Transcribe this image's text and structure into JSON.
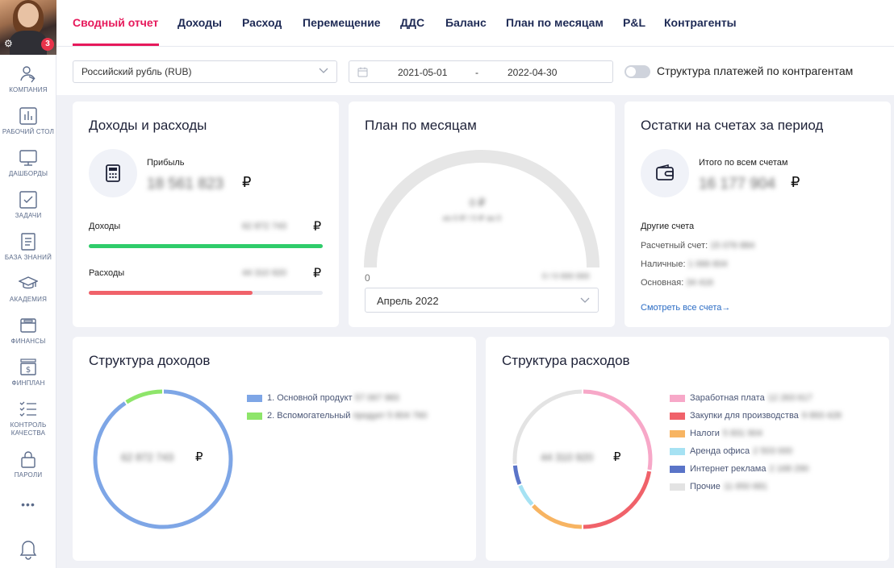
{
  "user": {
    "notifications": "3"
  },
  "sidebar": {
    "items": [
      {
        "label": "КОМПАНИЯ",
        "icon": "company-icon"
      },
      {
        "label": "РАБОЧИЙ СТОЛ",
        "icon": "chart-bars-icon"
      },
      {
        "label": "ДАШБОРДЫ",
        "icon": "monitor-icon"
      },
      {
        "label": "ЗАДАЧИ",
        "icon": "checkbox-icon"
      },
      {
        "label": "БАЗА ЗНАНИЙ",
        "icon": "document-icon"
      },
      {
        "label": "АКАДЕМИЯ",
        "icon": "graduation-cap-icon"
      },
      {
        "label": "ФИНАНСЫ",
        "icon": "wallet-icon"
      },
      {
        "label": "ФИНПЛАН",
        "icon": "dollar-icon"
      },
      {
        "label": "КОНТРОЛЬ КАЧЕСТВА",
        "icon": "checklist-icon"
      },
      {
        "label": "ПАРОЛИ",
        "icon": "lock-icon"
      }
    ],
    "more": "•••"
  },
  "tabs": [
    {
      "label": "Сводный отчет",
      "active": true
    },
    {
      "label": "Доходы"
    },
    {
      "label": "Расход"
    },
    {
      "label": "Перемещение"
    },
    {
      "label": "ДДС"
    },
    {
      "label": "Баланс"
    },
    {
      "label": "План по месяцам"
    },
    {
      "label": "P&L"
    },
    {
      "label": "Контрагенты"
    }
  ],
  "filters": {
    "currency": "Российский рубль (RUB)",
    "date_from": "2021-05-01",
    "date_sep": "-",
    "date_to": "2022-04-30",
    "toggle_label": "Структура платежей по контрагентам",
    "toggle_on": false
  },
  "income_expense": {
    "title": "Доходы и расходы",
    "profit_label": "Прибыль",
    "profit_value": "18 561 823",
    "currency_sign": "₽",
    "income_label": "Доходы",
    "income_value": "62 872 743",
    "income_fill": 1.0,
    "expense_label": "Расходы",
    "expense_value": "44 310 920",
    "expense_fill": 0.7
  },
  "monthly_plan": {
    "title": "План по месяцам",
    "gauge_value": "0 ₽",
    "gauge_sub": "из 0 ₽ / 0 ₽ за 0",
    "gauge_min": "0",
    "gauge_max_hidden": "0 / 0 000 000",
    "month": "Апрель 2022"
  },
  "balances": {
    "title": "Остатки на счетах за период",
    "total_label": "Итого по всем счетам",
    "total_value": "16 177 904",
    "currency_sign": "₽",
    "other_label": "Другие счета",
    "accounts": [
      {
        "label": "Расчетный счет:",
        "value": "15 076 884"
      },
      {
        "label": "Наличные:",
        "value": "1 066 604"
      },
      {
        "label": "Основная:",
        "value": "34 416"
      }
    ],
    "see_all": "Смотреть все счета→"
  },
  "income_structure": {
    "title": "Структура доходов",
    "total": "62 872 743",
    "currency_sign": "₽",
    "legend": [
      {
        "label": "1. Основной продукт",
        "value": "57 067 983",
        "color": "#7ea6e6"
      },
      {
        "label": "2. Вспомогательный",
        "value": "продукт 5 804 760",
        "color": "#8ee56a"
      }
    ]
  },
  "expense_structure": {
    "title": "Структура расходов",
    "total": "44 310 920",
    "currency_sign": "₽",
    "legend": [
      {
        "label": "Заработная плата",
        "value": "12 263 617",
        "color": "#f7a8c8"
      },
      {
        "label": "Закупки для производства",
        "value": "9 893 428",
        "color": "#f0626a"
      },
      {
        "label": "Налоги",
        "value": "5 831 904",
        "color": "#f7b462"
      },
      {
        "label": "Аренда офиса",
        "value": "2 503 000",
        "color": "#a6e2f3"
      },
      {
        "label": "Интернет реклама",
        "value": "2 168 290",
        "color": "#5a74c8"
      },
      {
        "label": "Прочие",
        "value": "11 650 681",
        "color": "#e3e3e3"
      }
    ]
  }
}
